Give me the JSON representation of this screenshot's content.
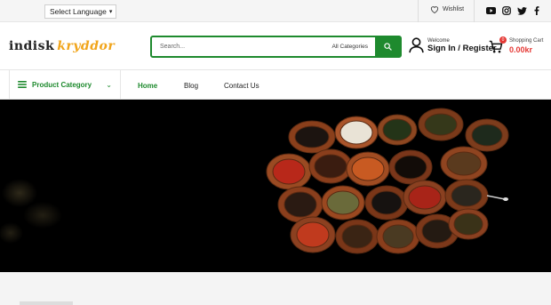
{
  "topbar": {
    "language_label": "Select Language",
    "wishlist_label": "Wishlist",
    "social": [
      "youtube-icon",
      "instagram-icon",
      "twitter-icon",
      "facebook-icon"
    ]
  },
  "header": {
    "logo_part1": "indisk",
    "logo_part2": "kryddor",
    "search_placeholder": "Search...",
    "search_category": "All Categories",
    "welcome": "Welcome",
    "signin": "Sign In / Register",
    "cart_count": "0",
    "cart_label": "Shopping Cart",
    "cart_total": "0.00kr"
  },
  "nav": {
    "category_label": "Product Category",
    "links": [
      "Home",
      "Blog",
      "Contact Us"
    ]
  },
  "colors": {
    "accent": "#1e8a2e",
    "price": "#e53935",
    "logo_secondary": "#f1a51b"
  }
}
